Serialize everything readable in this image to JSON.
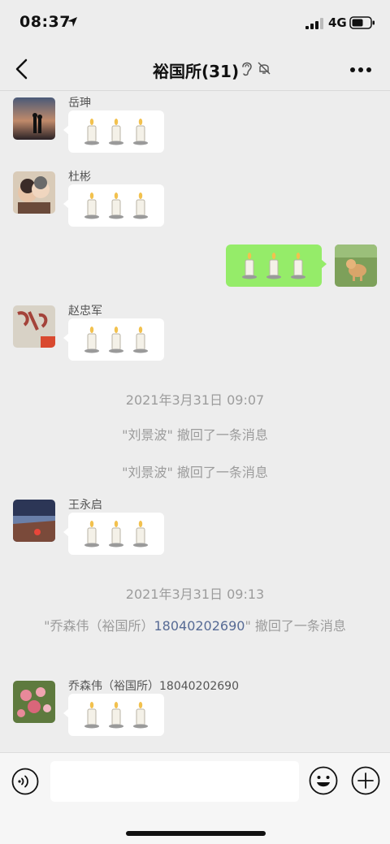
{
  "status_bar": {
    "time": "08:37",
    "network": "4G"
  },
  "header": {
    "title": "裕国所(31)"
  },
  "messages": [
    {
      "sender": "岳珅",
      "content": "🕯️🕯️🕯️"
    },
    {
      "sender": "杜彬",
      "content": "🕯️🕯️🕯️"
    },
    {
      "sender": "",
      "content": "🕯️🕯️🕯️",
      "mine": true
    },
    {
      "sender": "赵忠军",
      "content": "🕯️🕯️🕯️"
    },
    {
      "sender": "王永启",
      "content": "🕯️🕯️🕯️"
    },
    {
      "sender": "乔森伟（裕国所）18040202690",
      "content": "🕯️🕯️🕯️"
    }
  ],
  "system": {
    "ts1": "2021年3月31日 09:07",
    "recall1": "\"刘景波\" 撤回了一条消息",
    "recall2": "\"刘景波\" 撤回了一条消息",
    "ts2": "2021年3月31日 09:13",
    "recall3_prefix": "\"乔森伟（裕国所）",
    "recall3_phone": "18040202690",
    "recall3_suffix": "\" 撤回了一条消息"
  },
  "input": {
    "value": "",
    "placeholder": ""
  },
  "colors": {
    "my_bubble": "#95ec69",
    "link": "#576b95",
    "background": "#ededed"
  }
}
